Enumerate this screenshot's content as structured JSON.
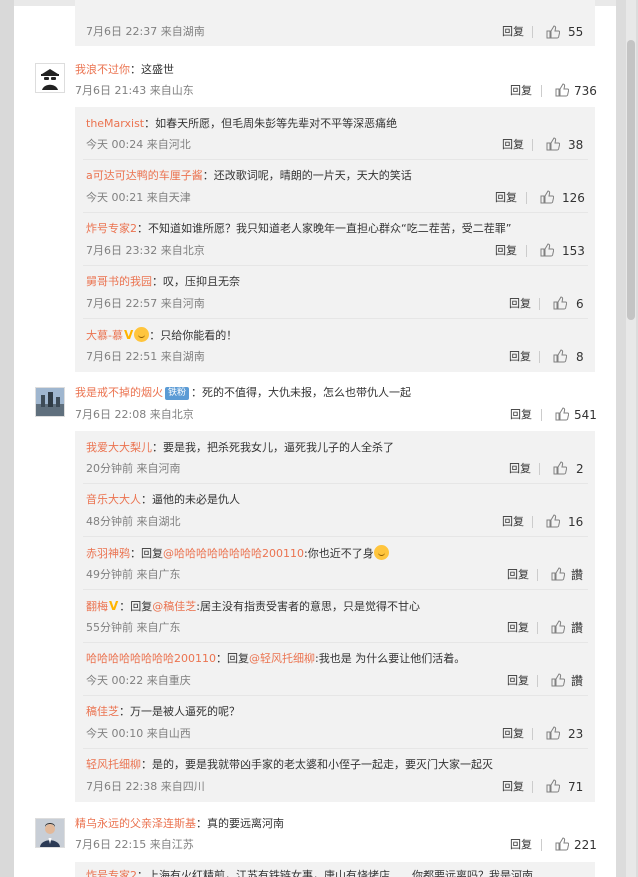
{
  "top_partial": {
    "meta": "7月6日 22:37 来自湖南",
    "likes": "55"
  },
  "reply_label": "回复",
  "threads": [
    {
      "author": "我浪不过你",
      "text": "这盛世",
      "meta": "7月6日 21:43 来自山东",
      "likes": "736",
      "replies": [
        {
          "author": "theMarxist",
          "text": "如春天所愿，但毛周朱彭等先辈对不平等深恶痛绝",
          "meta": "今天 00:24 来自河北",
          "likes": "38"
        },
        {
          "author": "a可达可达鸭的车厘子酱",
          "text": "还改歌词呢，晴朗的一片天，天大的笑话",
          "meta": "今天 00:21 来自天津",
          "likes": "126"
        },
        {
          "author": "炸号专家2",
          "text": "不知道如谁所愿？我只知道老人家晚年一直担心群众“吃二茬苦，受二茬罪”",
          "meta": "7月6日 23:32 来自北京",
          "likes": "153"
        },
        {
          "author": "舅哥书的我园",
          "text": "叹，压抑且无奈",
          "meta": "7月6日 22:57 来自河南",
          "likes": "6"
        },
        {
          "author": "大慕-慕",
          "text": "只给你能看的！",
          "meta": "7月6日 22:51 来自湖南",
          "likes": "8"
        }
      ]
    },
    {
      "author": "我是戒不掉的烟火",
      "badge": "铁粉",
      "text": "死的不值得，大仇未报，怎么也带仇人一起",
      "meta": "7月6日 22:08 来自北京",
      "likes": "541",
      "replies": [
        {
          "author": "我爱大大梨儿",
          "text": "要是我，把杀死我女儿，逼死我儿子的人全杀了",
          "meta": "20分钟前 来自河南",
          "likes": "2"
        },
        {
          "author": "音乐大大人",
          "text": "逼他的未必是仇人",
          "meta": "48分钟前 来自湖北",
          "likes": "16"
        },
        {
          "author": "赤羽神鸦",
          "reply_prefix": "回复",
          "mention": "@哈哈哈哈哈哈哈哈200110",
          "text": ":你也近不了身",
          "meta": "49分钟前 来自广东",
          "likes": "讚"
        },
        {
          "author": "翻梅",
          "reply_prefix": "回复",
          "mention": "@稿佳芝",
          "text": ":居主没有指责受害者的意思，只是觉得不甘心",
          "meta": "55分钟前 来自广东",
          "likes": "讚"
        },
        {
          "author": "哈哈哈哈哈哈哈哈200110",
          "reply_prefix": "回复",
          "mention": "@轻风托细柳",
          "text": ":我也是 为什么要让他们活着。",
          "meta": "今天 00:22 来自重庆",
          "likes": "讚"
        },
        {
          "author": "稿佳芝",
          "text": "万一是被人逼死的呢？",
          "meta": "今天 00:10 来自山西",
          "likes": "23"
        },
        {
          "author": "轻风托细柳",
          "text": "是的，要是我就带凶手家的老太婆和小侄子一起走，要灭门大家一起灭",
          "meta": "7月6日 22:38 来自四川",
          "likes": "71"
        }
      ]
    },
    {
      "author": "精乌永远的父亲泽连斯基",
      "text": "真的要远离河南",
      "meta": "7月6日 22:15 来自江苏",
      "likes": "221"
    }
  ],
  "bottom_partial": {
    "author": "炸号专家2",
    "text": "上海有火红精煎，江苏有铁链女事，唐山有烧烤店……你都要远离吗？我是河南"
  }
}
